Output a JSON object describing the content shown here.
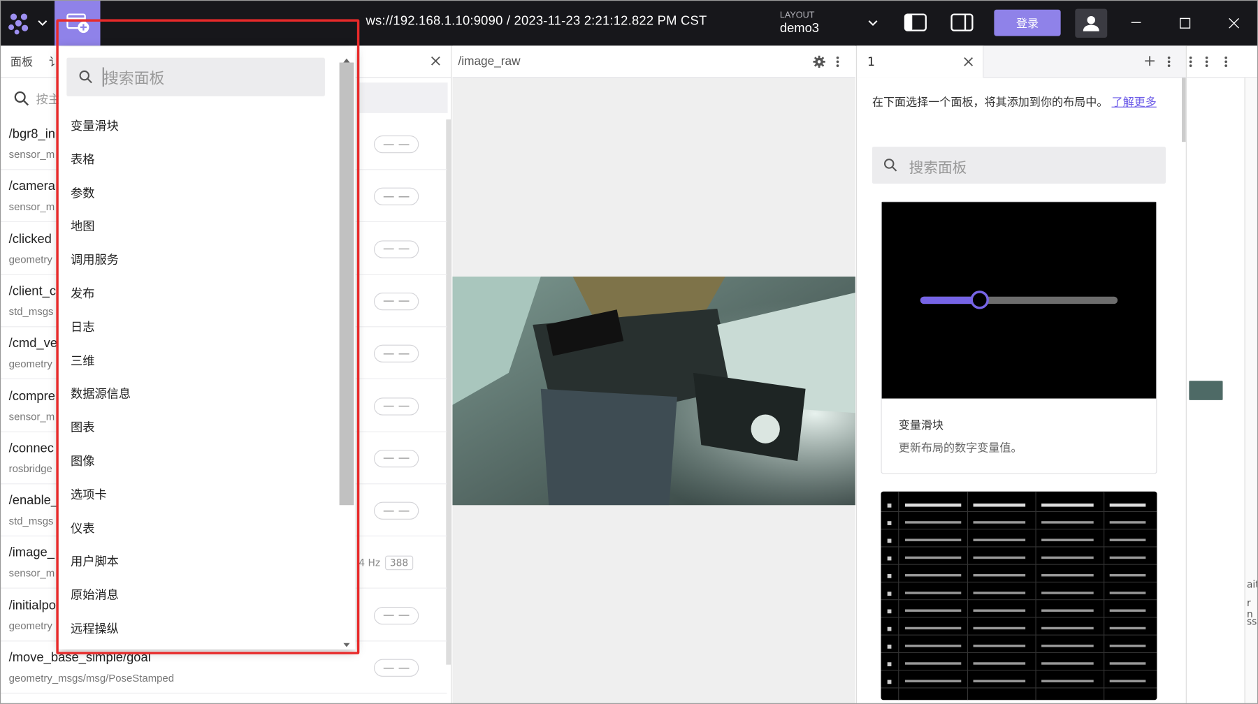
{
  "topbar": {
    "connection": "ws://192.168.1.10:9090 / 2023-11-23 2:21:12.822 PM CST",
    "layout_label": "LAYOUT",
    "layout_name": "demo3",
    "login_label": "登录"
  },
  "left_panel": {
    "tabs": [
      "面板",
      "讠"
    ],
    "search_placeholder": "按主",
    "topics": [
      {
        "name": "/bgr8_in",
        "type": "sensor_m",
        "freq": "",
        "count": ""
      },
      {
        "name": "/camera",
        "type": "sensor_m",
        "freq": "",
        "count": ""
      },
      {
        "name": "/clicked",
        "type": "geometry",
        "freq": "",
        "count": ""
      },
      {
        "name": "/client_c",
        "type": "std_msgs",
        "freq": "",
        "count": ""
      },
      {
        "name": "/cmd_ve",
        "type": "geometry",
        "freq": "",
        "count": ""
      },
      {
        "name": "/compre",
        "type": "sensor_m",
        "freq": "",
        "count": ""
      },
      {
        "name": "/connec",
        "type": "rosbridge",
        "freq": "",
        "count": ""
      },
      {
        "name": "/enable_",
        "type": "std_msgs",
        "freq": "",
        "count": ""
      },
      {
        "name": "/image_",
        "type": "sensor_m",
        "freq": "4 Hz",
        "count": "388"
      },
      {
        "name": "/initialpo",
        "type": "geometry",
        "freq": "",
        "count": ""
      },
      {
        "name": "/move_base_simple/goal",
        "type": "geometry_msgs/msg/PoseStamped",
        "freq": "",
        "count": ""
      }
    ]
  },
  "middle_panel": {
    "title": "/image_raw"
  },
  "right_panel": {
    "tab_label": "1",
    "intro_text": "在下面选择一个面板，将其添加到你的布局中。",
    "learn_more": "了解更多",
    "search_placeholder": "搜索面板",
    "cards": [
      {
        "title": "变量滑块",
        "description": "更新布局的数字变量值。"
      }
    ]
  },
  "far_right": {
    "partial_text": [
      "ait",
      "r n",
      "ss"
    ]
  },
  "dropdown": {
    "search_placeholder": "搜索面板",
    "items": [
      "变量滑块",
      "表格",
      "参数",
      "地图",
      "调用服务",
      "发布",
      "日志",
      "三维",
      "数据源信息",
      "图表",
      "图像",
      "选项卡",
      "仪表",
      "用户脚本",
      "原始消息",
      "远程操纵"
    ]
  },
  "colors": {
    "accent": "#8f82e9",
    "topbar": "#17171b",
    "highlight": "#e82a2a"
  }
}
